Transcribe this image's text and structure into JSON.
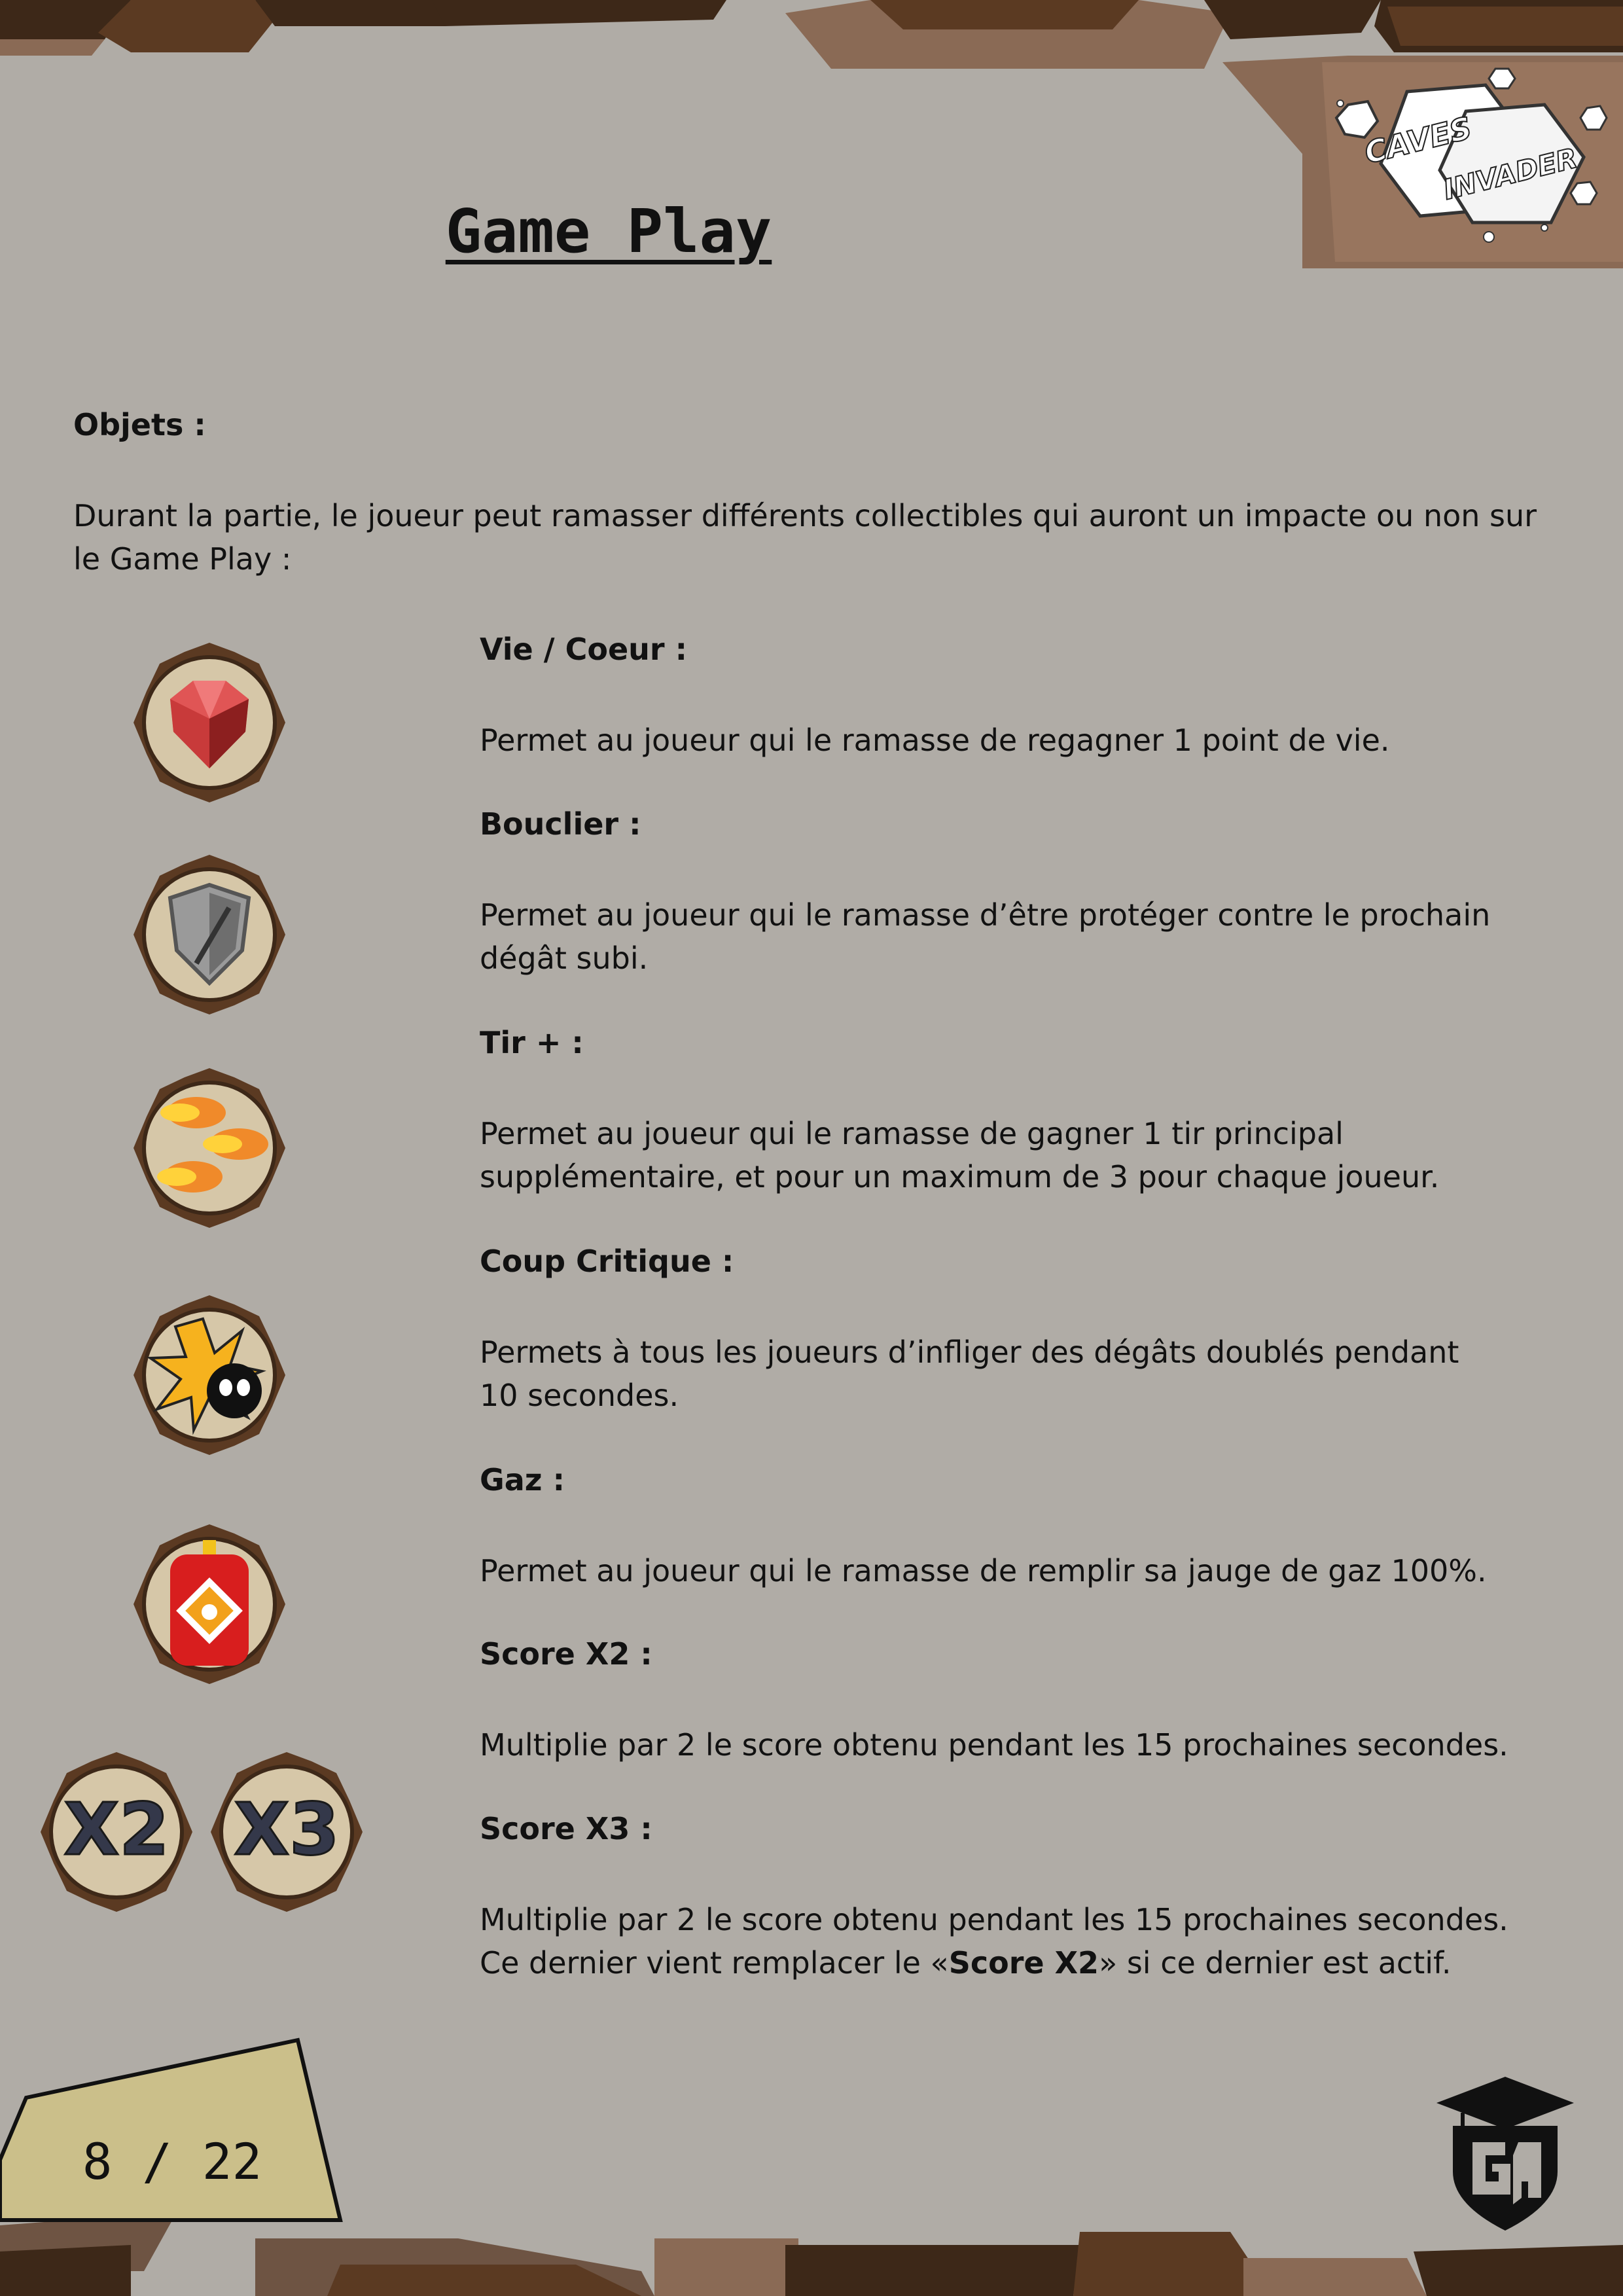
{
  "page": {
    "title": "Game Play",
    "page_number": "8 / 22",
    "logo": {
      "line1": "CAVES",
      "line2": "INVADER"
    }
  },
  "section": {
    "heading": "Objets :",
    "intro": "Durant la partie, le joueur peut ramasser différents collectibles qui auront un impacte ou non sur le Game Play :"
  },
  "items": [
    {
      "name": "Vie / Coeur :",
      "icon": "heart-icon",
      "description": "Permet au joueur qui le ramasse de regagner 1 point de vie."
    },
    {
      "name": "Bouclier :",
      "icon": "shield-icon",
      "description": "Permet au joueur qui le ramasse d’être protéger contre le prochain dégât subi."
    },
    {
      "name": "Tir + :",
      "icon": "fireballs-icon",
      "description": "Permet au joueur qui le ramasse de gagner 1 tir principal supplémentaire, et pour un maximum de 3 pour chaque joueur."
    },
    {
      "name": "Coup Critique :",
      "icon": "critical-hit-icon",
      "description": "Permets à tous les joueurs d’infliger des dégâts doublés pendant 10 secondes."
    },
    {
      "name": "Gaz :",
      "icon": "gas-canister-icon",
      "description": "Permet au joueur qui le ramasse de remplir sa jauge de gaz 100%."
    },
    {
      "name": "Score X2 :",
      "icon": "x2-icon",
      "badge_text": "X2",
      "description": "Multiplie par 2 le score obtenu pendant les 15 prochaines secondes."
    },
    {
      "name": "Score X3 :",
      "icon": "x3-icon",
      "badge_text": "X3",
      "description_lines": [
        "Multiplie par 2 le score obtenu pendant les 15 prochaines secondes.",
        "Ce dernier vient remplacer le «",
        "Score X2",
        "» si ce dernier est actif."
      ]
    }
  ],
  "colors": {
    "background": "#b0aca6",
    "dark_brown": "#3d2818",
    "mid_brown": "#5b3a22",
    "light_brown": "#8a6a55",
    "badge_fill": "#d6c7a8",
    "page_tag": "#cbbf8a"
  }
}
